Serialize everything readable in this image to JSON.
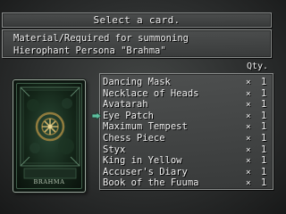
{
  "header": {
    "title": "Select a card."
  },
  "info": {
    "line1": "Material/Required for summoning",
    "line2": "Hierophant Persona \"Brahma\""
  },
  "list": {
    "qty_header": "Qty.",
    "times_symbol": "×",
    "selected_index": 3,
    "items": [
      {
        "name": "Dancing Mask",
        "qty": "1"
      },
      {
        "name": "Necklace of Heads",
        "qty": "1"
      },
      {
        "name": "Avatarah",
        "qty": "1"
      },
      {
        "name": "Eye Patch",
        "qty": "1"
      },
      {
        "name": "Maximum Tempest",
        "qty": "1"
      },
      {
        "name": "Chess Piece",
        "qty": "1"
      },
      {
        "name": "Styx",
        "qty": "1"
      },
      {
        "name": "King in Yellow",
        "qty": "1"
      },
      {
        "name": "Accuser's Diary",
        "qty": "1"
      },
      {
        "name": "Book of the Fuuma",
        "qty": "1"
      }
    ]
  },
  "card": {
    "label": "BRAHMA"
  },
  "colors": {
    "cursor": "#5fbf9f",
    "card_green": "#2a4a36",
    "sigil_gold": "#c9b06a"
  },
  "icons": {
    "cursor": "pointer-hand-icon",
    "sigil": "persona-sigil-icon"
  }
}
